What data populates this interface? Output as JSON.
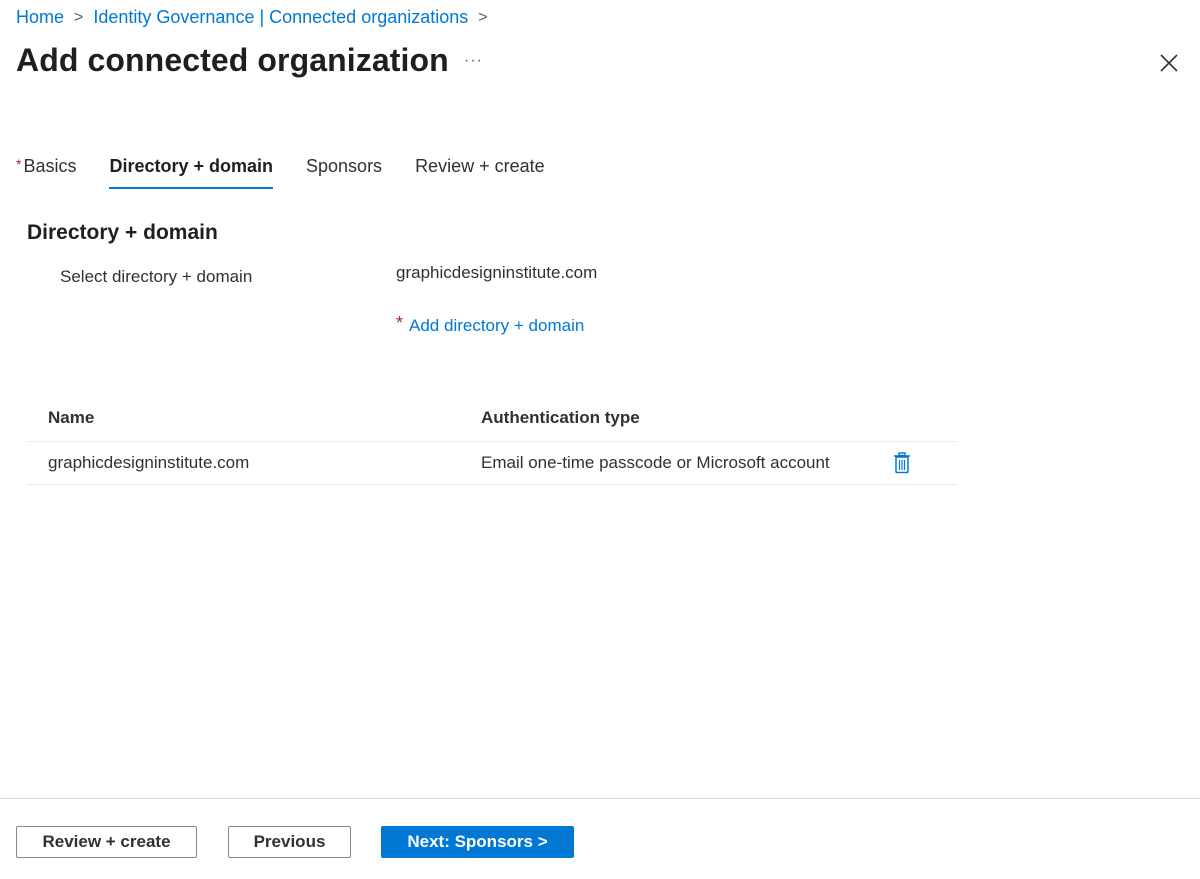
{
  "breadcrumb": {
    "items": [
      "Home",
      "Identity Governance | Connected organizations"
    ],
    "separator": ">"
  },
  "header": {
    "title": "Add connected organization",
    "more_label": "···",
    "close_icon": "close-icon"
  },
  "tabs": [
    {
      "label": "Basics",
      "required": true,
      "required_marker": "*",
      "active": false
    },
    {
      "label": "Directory + domain",
      "required": false,
      "active": true
    },
    {
      "label": "Sponsors",
      "required": false,
      "active": false
    },
    {
      "label": "Review + create",
      "required": false,
      "active": false
    }
  ],
  "section": {
    "title": "Directory + domain",
    "field_label": "Select directory + domain",
    "field_value": "graphicdesigninstitute.com",
    "required_marker": "*",
    "add_link": "Add directory + domain"
  },
  "table": {
    "columns": [
      "Name",
      "Authentication type"
    ],
    "rows": [
      {
        "name": "graphicdesigninstitute.com",
        "auth_type": "Email one-time passcode or Microsoft account",
        "action_icon": "trash-icon"
      }
    ]
  },
  "footer": {
    "review_create": "Review + create",
    "previous": "Previous",
    "next": "Next: Sponsors >"
  },
  "colors": {
    "accent": "#0078d4",
    "required": "#a4262c",
    "text": "#323130"
  }
}
